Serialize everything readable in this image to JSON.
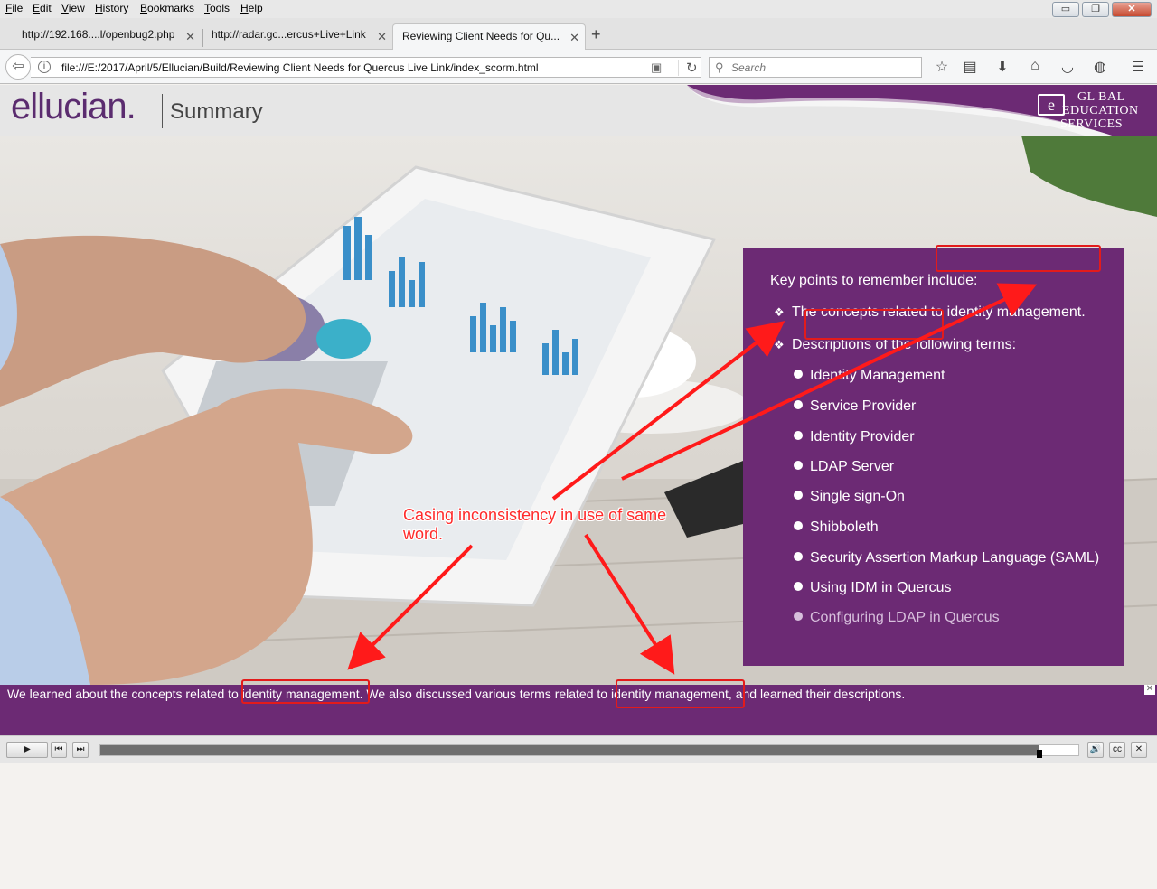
{
  "menubar": {
    "items": [
      "File",
      "Edit",
      "View",
      "History",
      "Bookmarks",
      "Tools",
      "Help"
    ],
    "window_buttons": {
      "minimize": "▭",
      "restore": "❐",
      "close": "✕"
    }
  },
  "tabs": [
    {
      "label": "http://192.168....l/openbug2.php",
      "close": "✕"
    },
    {
      "label": "http://radar.gc...ercus+Live+Link",
      "close": "✕"
    },
    {
      "label": "Reviewing Client Needs for Qu...",
      "close": "✕"
    }
  ],
  "new_tab": "+",
  "navbar": {
    "url": "file:///E:/2017/April/5/Ellucian/Build/Reviewing Client Needs for Quercus Live Link/index_scorm.html",
    "search_placeholder": "Search"
  },
  "course": {
    "logo": "ellucian.",
    "page_title": "Summary",
    "partner_logo": {
      "mark": "e",
      "line1": "GL  BAL",
      "line2": "EDUCATION",
      "line3": "SERVICES"
    },
    "key_points": {
      "heading": "Key points to remember include:",
      "points": [
        "The concepts related to identity management.",
        "Descriptions of the following terms:"
      ],
      "terms": [
        "Identity Management",
        "Service Provider",
        "Identity Provider",
        "LDAP Server",
        "Single sign-On",
        "Shibboleth",
        "Security Assertion Markup Language (SAML)",
        "Using IDM in Quercus",
        "Configuring LDAP in Quercus"
      ]
    },
    "caption": "We learned about the concepts related to identity management. We also discussed various terms related to identity management, and learned their descriptions.",
    "player": {
      "progress": 0.96
    }
  },
  "annotation": {
    "text": "Casing inconsistency in use of same word."
  },
  "colors": {
    "brand_purple": "#6c2a74",
    "annotation_red": "#e31b1b"
  }
}
